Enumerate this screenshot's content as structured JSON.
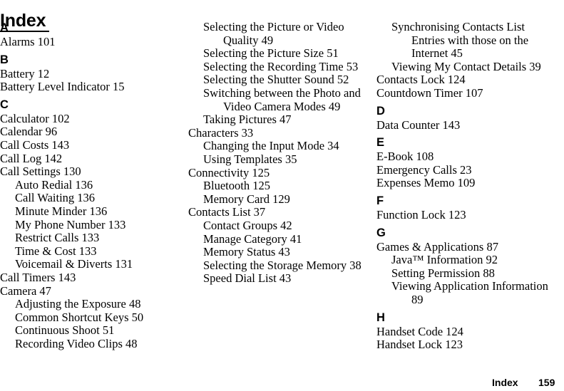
{
  "document": {
    "title": "Index",
    "footer": {
      "label": "Index",
      "page_number": "159"
    }
  },
  "columns": [
    {
      "name": "column-1",
      "blocks": [
        {
          "type": "letter",
          "text": "A"
        },
        {
          "type": "entry",
          "level": 0,
          "text": "Alarms 101"
        },
        {
          "type": "letter",
          "text": "B"
        },
        {
          "type": "entry",
          "level": 0,
          "text": "Battery 12"
        },
        {
          "type": "entry",
          "level": 0,
          "text": "Battery Level Indicator 15"
        },
        {
          "type": "letter",
          "text": "C"
        },
        {
          "type": "entry",
          "level": 0,
          "text": "Calculator 102"
        },
        {
          "type": "entry",
          "level": 0,
          "text": "Calendar 96"
        },
        {
          "type": "entry",
          "level": 0,
          "text": "Call Costs 143"
        },
        {
          "type": "entry",
          "level": 0,
          "text": "Call Log 142"
        },
        {
          "type": "entry",
          "level": 0,
          "text": "Call Settings 130"
        },
        {
          "type": "entry",
          "level": 1,
          "text": "Auto Redial 136"
        },
        {
          "type": "entry",
          "level": 1,
          "text": "Call Waiting 136"
        },
        {
          "type": "entry",
          "level": 1,
          "text": "Minute Minder 136"
        },
        {
          "type": "entry",
          "level": 1,
          "text": "My Phone Number 133"
        },
        {
          "type": "entry",
          "level": 1,
          "text": "Restrict Calls 133"
        },
        {
          "type": "entry",
          "level": 1,
          "text": "Time & Cost 133"
        },
        {
          "type": "entry",
          "level": 1,
          "text": "Voicemail & Diverts 131"
        },
        {
          "type": "entry",
          "level": 0,
          "text": "Call Timers 143"
        },
        {
          "type": "entry",
          "level": 0,
          "text": "Camera 47"
        },
        {
          "type": "entry",
          "level": 1,
          "text": "Adjusting the Exposure 48"
        },
        {
          "type": "entry",
          "level": 1,
          "text": "Common Shortcut Keys 50"
        },
        {
          "type": "entry",
          "level": 1,
          "text": "Continuous Shoot 51"
        },
        {
          "type": "entry",
          "level": 1,
          "text": "Recording Video Clips 48"
        }
      ]
    },
    {
      "name": "column-2",
      "blocks": [
        {
          "type": "entry",
          "level": 1,
          "text": "Selecting the Picture or Video Quality 49"
        },
        {
          "type": "entry",
          "level": 1,
          "text": "Selecting the Picture Size 51"
        },
        {
          "type": "entry",
          "level": 1,
          "text": "Selecting the Recording Time 53"
        },
        {
          "type": "entry",
          "level": 1,
          "text": "Selecting the Shutter Sound 52"
        },
        {
          "type": "entry",
          "level": 1,
          "text": "Switching between the Photo and Video Camera Modes 49"
        },
        {
          "type": "entry",
          "level": 1,
          "text": "Taking Pictures 47"
        },
        {
          "type": "entry",
          "level": 0,
          "text": "Characters 33"
        },
        {
          "type": "entry",
          "level": 1,
          "text": "Changing the Input Mode 34"
        },
        {
          "type": "entry",
          "level": 1,
          "text": "Using Templates 35"
        },
        {
          "type": "entry",
          "level": 0,
          "text": "Connectivity 125"
        },
        {
          "type": "entry",
          "level": 1,
          "text": "Bluetooth 125"
        },
        {
          "type": "entry",
          "level": 1,
          "text": "Memory Card 129"
        },
        {
          "type": "entry",
          "level": 0,
          "text": "Contacts List 37"
        },
        {
          "type": "entry",
          "level": 1,
          "text": "Contact Groups 42"
        },
        {
          "type": "entry",
          "level": 1,
          "text": "Manage Category 41"
        },
        {
          "type": "entry",
          "level": 1,
          "text": "Memory Status 43"
        },
        {
          "type": "entry",
          "level": 1,
          "text": "Selecting the Storage Memory 38"
        },
        {
          "type": "entry",
          "level": 1,
          "text": "Speed Dial List 43"
        }
      ]
    },
    {
      "name": "column-3",
      "blocks": [
        {
          "type": "entry",
          "level": 1,
          "text": "Synchronising Contacts List Entries with those on the Internet 45"
        },
        {
          "type": "entry",
          "level": 1,
          "text": "Viewing My Contact Details 39"
        },
        {
          "type": "entry",
          "level": 0,
          "text": "Contacts Lock 124"
        },
        {
          "type": "entry",
          "level": 0,
          "text": "Countdown Timer 107"
        },
        {
          "type": "letter",
          "text": "D"
        },
        {
          "type": "entry",
          "level": 0,
          "text": "Data Counter 143"
        },
        {
          "type": "letter",
          "text": "E"
        },
        {
          "type": "entry",
          "level": 0,
          "text": "E-Book 108"
        },
        {
          "type": "entry",
          "level": 0,
          "text": "Emergency Calls 23"
        },
        {
          "type": "entry",
          "level": 0,
          "text": "Expenses Memo 109"
        },
        {
          "type": "letter",
          "text": "F"
        },
        {
          "type": "entry",
          "level": 0,
          "text": "Function Lock 123"
        },
        {
          "type": "letter",
          "text": "G"
        },
        {
          "type": "entry",
          "level": 0,
          "text": "Games & Applications 87"
        },
        {
          "type": "entry",
          "level": 1,
          "text": "Java™ Information 92"
        },
        {
          "type": "entry",
          "level": 1,
          "text": "Setting Permission 88"
        },
        {
          "type": "entry",
          "level": 1,
          "text": "Viewing Application Information 89"
        },
        {
          "type": "letter",
          "text": "H"
        },
        {
          "type": "entry",
          "level": 0,
          "text": "Handset Code 124"
        },
        {
          "type": "entry",
          "level": 0,
          "text": "Handset Lock 123"
        }
      ]
    }
  ]
}
